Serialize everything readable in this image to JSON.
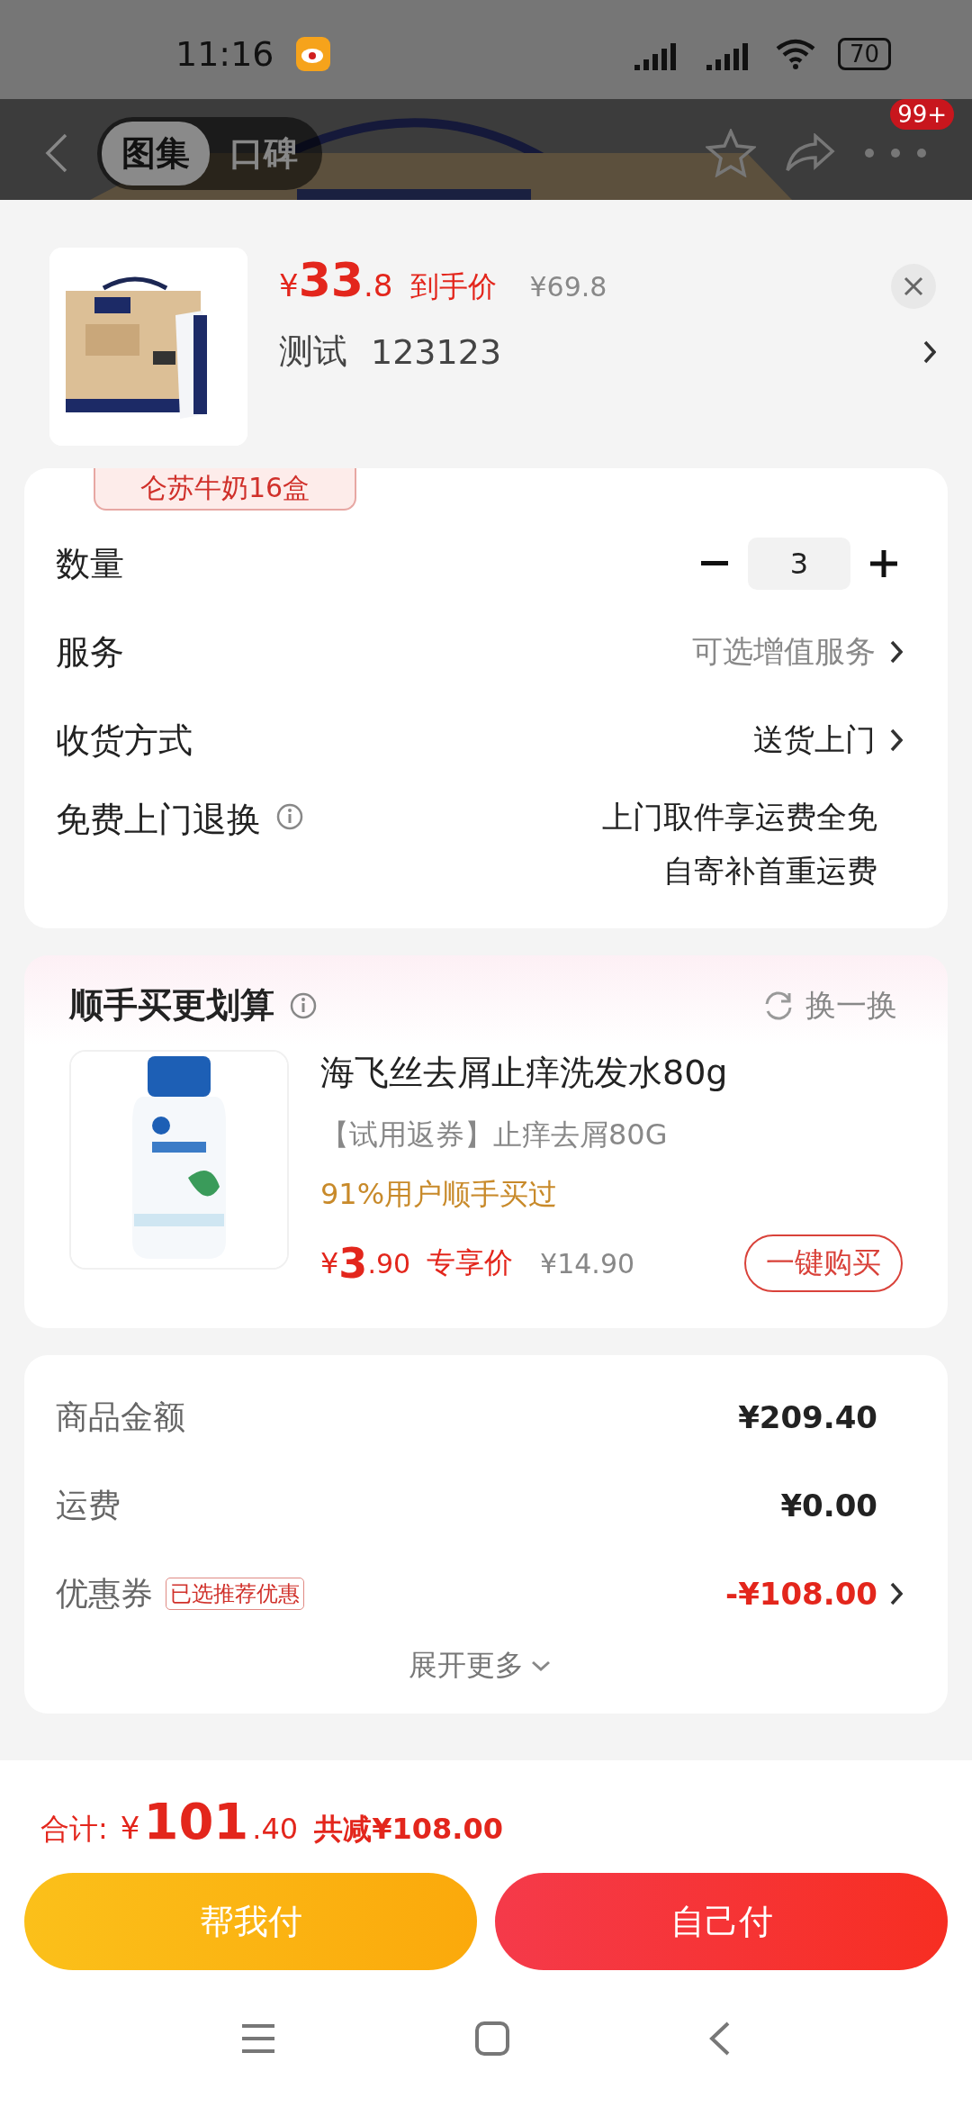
{
  "status_bar": {
    "time": "11:16",
    "battery": "70"
  },
  "nav": {
    "tabs": [
      {
        "label": "图集",
        "selected": true
      },
      {
        "label": "口碑",
        "selected": false
      }
    ],
    "badge": "99+"
  },
  "product": {
    "price_symbol": "¥",
    "price_int": "33",
    "price_dec": ".8",
    "price_label": "到手价",
    "original_price": "¥69.8",
    "spec_name": "测试",
    "spec_value": "123123",
    "variant_chip": "仑苏牛奶16盒"
  },
  "options": [
    {
      "kind": "stepper",
      "label": "数量",
      "value": "3"
    },
    {
      "kind": "link",
      "label": "服务",
      "value": "可选增值服务",
      "muted": true
    },
    {
      "kind": "link",
      "label": "收货方式",
      "value": "送货上门",
      "muted": false
    },
    {
      "kind": "info",
      "label": "免费上门退换",
      "lines": [
        "上门取件享运费全免",
        "自寄补首重运费"
      ]
    }
  ],
  "addon": {
    "title": "顺手买更划算",
    "refresh": "换一换",
    "item": {
      "name": "海飞丝去屑止痒洗发水80g",
      "subtitle": "【试用返券】止痒去屑80G",
      "social": "91%用户顺手买过",
      "price_symbol": "¥",
      "price_int": "3",
      "price_dec": ".90",
      "price_label": "专享价",
      "original_price": "¥14.90",
      "buy": "一键购买"
    }
  },
  "summary": {
    "rows": [
      {
        "kind": "plain",
        "label": "商品金额",
        "value": "¥209.40"
      },
      {
        "kind": "plain",
        "label": "运费",
        "value": "¥0.00"
      },
      {
        "kind": "discount",
        "label": "优惠券",
        "tag": "已选推荐优惠",
        "value": "-¥108.00"
      }
    ],
    "expand": "展开更多"
  },
  "footer": {
    "total_label": "合计:",
    "total_symbol": "¥",
    "total_int": "101",
    "total_dec": ".40",
    "saved": "共减¥108.00",
    "buttons": [
      {
        "kind": "friend",
        "label": "帮我付"
      },
      {
        "kind": "self",
        "label": "自己付"
      }
    ]
  }
}
